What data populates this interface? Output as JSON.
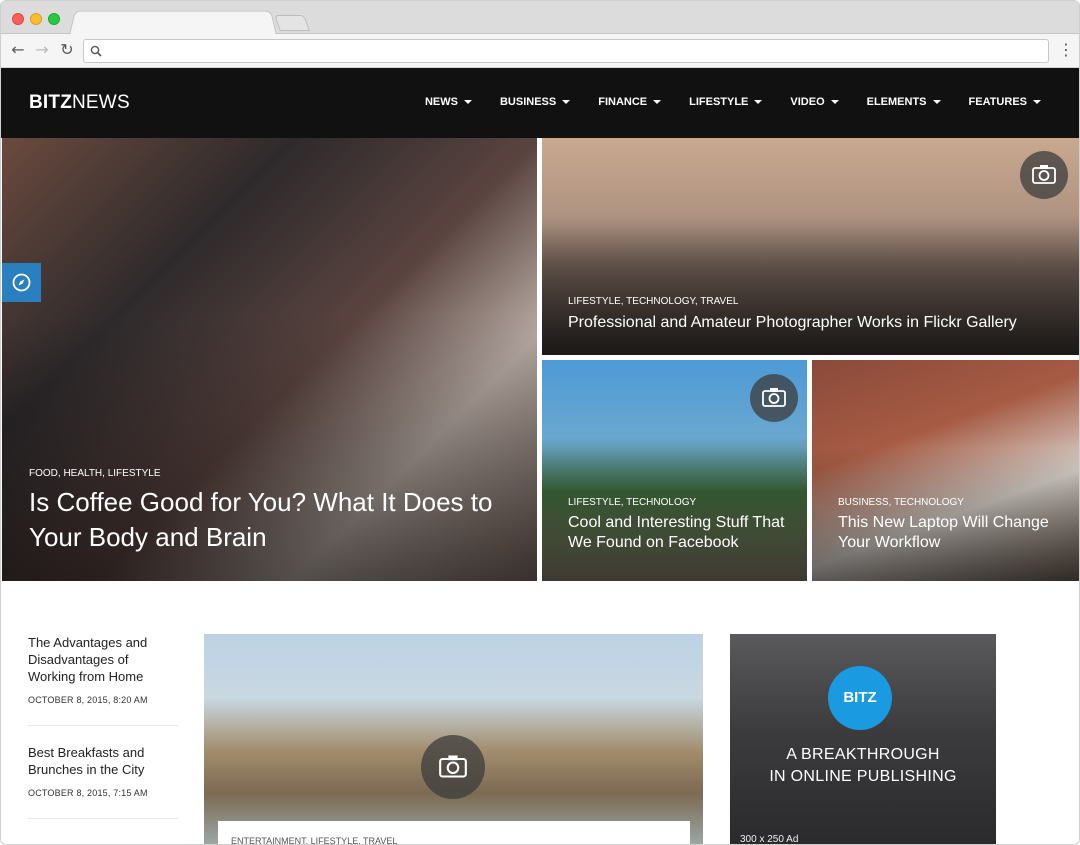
{
  "browser": {
    "nav": {
      "back": "←",
      "forward": "→",
      "reload": "↻",
      "menu": "⋮"
    },
    "icons": [
      "search-icon"
    ]
  },
  "site": {
    "logo_bold": "BITZ",
    "logo_light": "NEWS",
    "menu": [
      "NEWS",
      "BUSINESS",
      "FINANCE",
      "LIFESTYLE",
      "VIDEO",
      "ELEMENTS",
      "FEATURES"
    ]
  },
  "hero": {
    "main": {
      "cats": "FOOD, HEALTH, LIFESTYLE",
      "title": "Is Coffee Good for You? What It Does to Your Body and Brain"
    },
    "top_right": {
      "cats": "LIFESTYLE, TECHNOLOGY, TRAVEL",
      "title": "Professional and Amateur Photographer Works in Flickr Gallery"
    },
    "bottom_mid": {
      "cats": "LIFESTYLE, TECHNOLOGY",
      "title": "Cool and Interesting Stuff That We Found on Facebook"
    },
    "bottom_right": {
      "cats": "BUSINESS, TECHNOLOGY",
      "title": "This New Laptop Will Change Your Workflow"
    }
  },
  "sidebar": {
    "items": [
      {
        "title": "The Advantages and Disadvantages of Working from Home",
        "date": "OCTOBER 8, 2015, 8:20 AM"
      },
      {
        "title": "Best Breakfasts and Brunches in the City",
        "date": "OCTOBER 8, 2015, 7:15 AM"
      }
    ]
  },
  "feature": {
    "cats": "ENTERTAINMENT, LIFESTYLE, TRAVEL"
  },
  "ad": {
    "logo": "BITZ",
    "line1": "A BREAKTHROUGH",
    "line2": "IN ONLINE PUBLISHING",
    "size": "300 x 250 Ad"
  }
}
